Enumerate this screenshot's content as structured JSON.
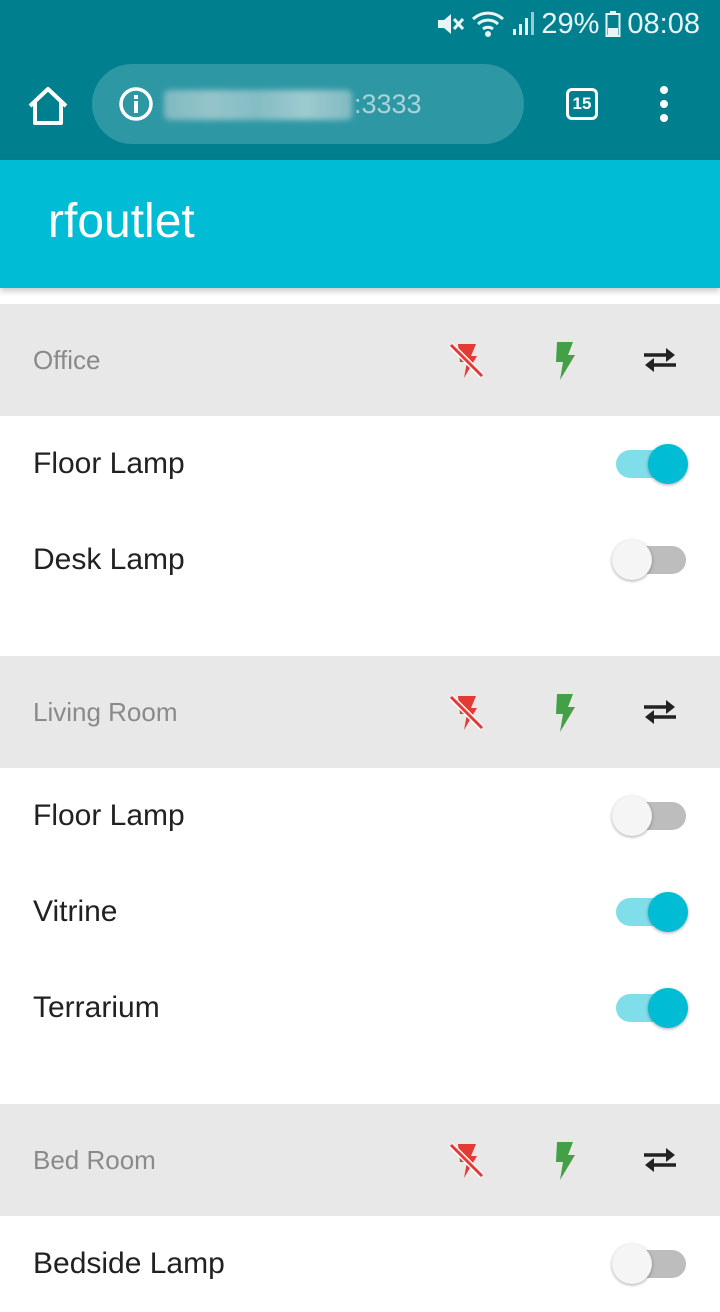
{
  "status_bar": {
    "battery": "29%",
    "time": "08:08",
    "icons": [
      "mute-icon",
      "wifi-icon",
      "signal-icon",
      "battery-icon"
    ]
  },
  "browser": {
    "url_visible": ":3333",
    "tab_count": "15",
    "icons": [
      "home-icon",
      "info-icon",
      "more-vert-icon"
    ]
  },
  "app": {
    "title": "rfoutlet",
    "colors": {
      "primary": "#00bcd4",
      "primary_dark": "#00808f",
      "off_red": "#e53935",
      "on_green": "#43a047"
    }
  },
  "groups": [
    {
      "name": "Office",
      "outlets": [
        {
          "name": "Floor Lamp",
          "on": true
        },
        {
          "name": "Desk Lamp",
          "on": false
        }
      ]
    },
    {
      "name": "Living Room",
      "outlets": [
        {
          "name": "Floor Lamp",
          "on": false
        },
        {
          "name": "Vitrine",
          "on": true
        },
        {
          "name": "Terrarium",
          "on": true
        }
      ]
    },
    {
      "name": "Bed Room",
      "outlets": [
        {
          "name": "Bedside Lamp",
          "on": false
        }
      ]
    }
  ]
}
